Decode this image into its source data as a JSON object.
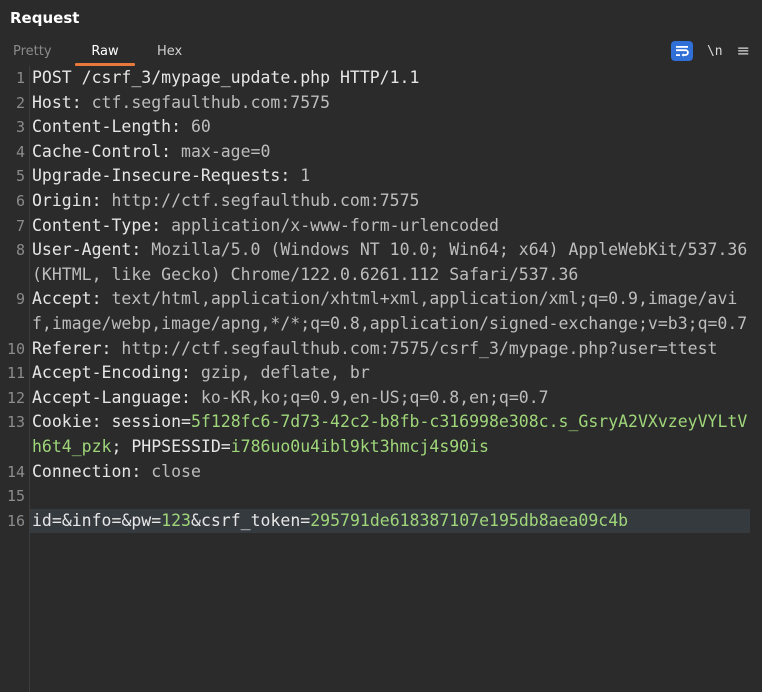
{
  "panel": {
    "title": "Request"
  },
  "tabs": [
    {
      "label": "Pretty"
    },
    {
      "label": "Raw"
    },
    {
      "label": "Hex"
    }
  ],
  "toolbar": {
    "newline_label": "\\n",
    "menu_label": "≡"
  },
  "lines": [
    {
      "num": "1",
      "text": "POST /csrf_3/mypage_update.php HTTP/1.1"
    },
    {
      "num": "2",
      "key": "Host",
      "value": "ctf.segfaulthub.com:7575"
    },
    {
      "num": "3",
      "key": "Content-Length",
      "value": "60"
    },
    {
      "num": "4",
      "key": "Cache-Control",
      "value": "max-age=0"
    },
    {
      "num": "5",
      "key": "Upgrade-Insecure-Requests",
      "value": "1"
    },
    {
      "num": "6",
      "key": "Origin",
      "value": "http://ctf.segfaulthub.com:7575"
    },
    {
      "num": "7",
      "key": "Content-Type",
      "value": "application/x-www-form-urlencoded"
    },
    {
      "num": "8",
      "key": "User-Agent",
      "value": "Mozilla/5.0 (Windows NT 10.0; Win64; x64) AppleWebKit/537.36 (KHTML, like Gecko) Chrome/122.0.6261.112 Safari/537.36"
    },
    {
      "num": "9",
      "key": "Accept",
      "value": "text/html,application/xhtml+xml,application/xml;q=0.9,image/avif,image/webp,image/apng,*/*;q=0.8,application/signed-exchange;v=b3;q=0.7"
    },
    {
      "num": "10",
      "key": "Referer",
      "value": "http://ctf.segfaulthub.com:7575/csrf_3/mypage.php?user=ttest"
    },
    {
      "num": "11",
      "key": "Accept-Encoding",
      "value": "gzip, deflate, br"
    },
    {
      "num": "12",
      "key": "Accept-Language",
      "value": "ko-KR,ko;q=0.9,en-US;q=0.8,en;q=0.7"
    },
    {
      "num": "13",
      "key": "Cookie",
      "cookie": {
        "name1": "session",
        "value1": "5f128fc6-7d73-42c2-b8fb-c316998e308c.s_GsryA2VXvzeyVYLtVh6t4_pzk",
        "name2": "PHPSESSID",
        "value2": "i786uo0u4ibl9kt3hmcj4s90is"
      }
    },
    {
      "num": "14",
      "key": "Connection",
      "value": "close"
    },
    {
      "num": "15",
      "text": ""
    },
    {
      "num": "16",
      "params": [
        {
          "k": "id",
          "v": ""
        },
        {
          "k": "info",
          "v": ""
        },
        {
          "k": "pw",
          "v": "123"
        },
        {
          "k": "csrf_token",
          "v": "295791de618387107e195db8aea09c4b"
        }
      ]
    }
  ]
}
